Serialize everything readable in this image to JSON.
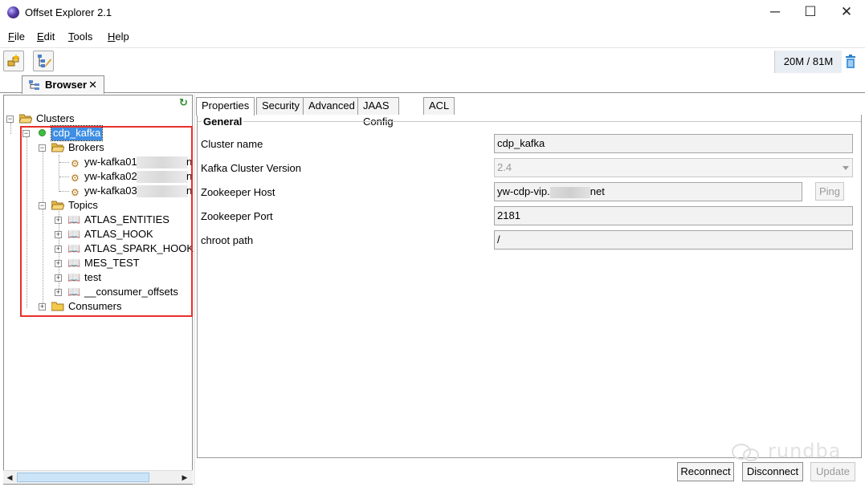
{
  "window": {
    "title": "Offset Explorer  2.1",
    "minimize": "─",
    "maximize": "☐",
    "close": "✕"
  },
  "menu": {
    "file": {
      "key": "F",
      "rest": "ile"
    },
    "edit": {
      "key": "E",
      "rest": "dit"
    },
    "tools": {
      "key": "T",
      "rest": "ools"
    },
    "help": {
      "key": "H",
      "rest": "elp"
    }
  },
  "toolbar": {
    "memory": "20M / 81M"
  },
  "browser_tab": {
    "label": "Browser",
    "close": "✕"
  },
  "tree": {
    "root": "Clusters",
    "cluster": "cdp_kafka",
    "brokers_folder": "Brokers",
    "brokers": [
      "yw-kafka01",
      "yw-kafka02",
      "yw-kafka03"
    ],
    "broker_suffix": "n",
    "topics_folder": "Topics",
    "topics": [
      "ATLAS_ENTITIES",
      "ATLAS_HOOK",
      "ATLAS_SPARK_HOOK",
      "MES_TEST",
      "test",
      "__consumer_offsets"
    ],
    "consumers_folder": "Consumers"
  },
  "tabs": [
    "Properties",
    "Security",
    "Advanced",
    "JAAS Config",
    "ACL"
  ],
  "general": {
    "group_title": "General",
    "cluster_name_label": "Cluster name",
    "cluster_name": "cdp_kafka",
    "version_label": "Kafka Cluster Version",
    "version": "2.4",
    "zk_host_label": "Zookeeper Host",
    "zk_host_prefix": "yw-cdp-vip.",
    "zk_host_suffix": "net",
    "ping": "Ping",
    "zk_port_label": "Zookeeper Port",
    "zk_port": "2181",
    "chroot_label": "chroot path",
    "chroot": "/"
  },
  "buttons": {
    "reconnect": "Reconnect",
    "disconnect": "Disconnect",
    "update": "Update"
  },
  "watermark": "rundba",
  "colors": {
    "selection": "#3d8ee4",
    "highlight_box": "#e8302b",
    "folder": "#f2c94c",
    "online": "#3fbf3f"
  }
}
